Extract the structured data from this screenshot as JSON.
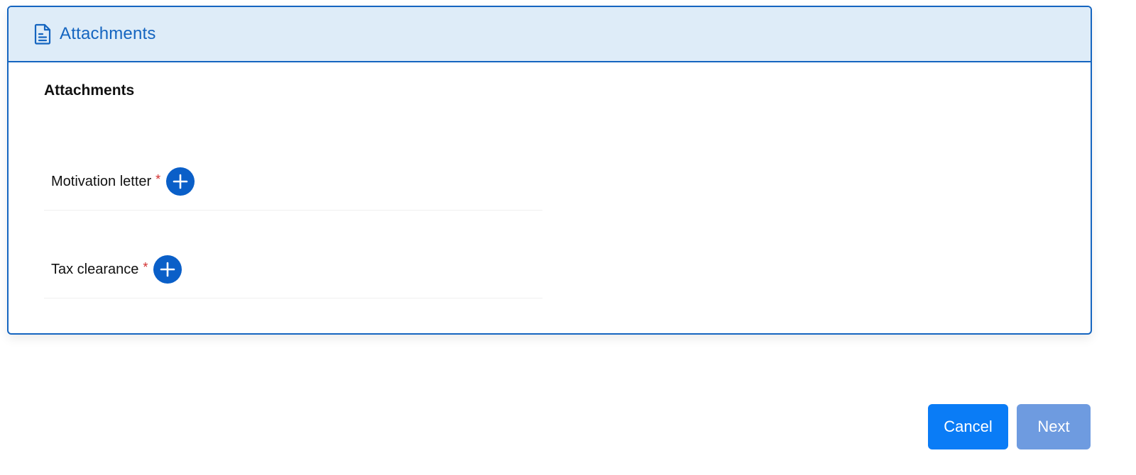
{
  "panel": {
    "header_title": "Attachments",
    "header_icon": "document-icon",
    "accent_color": "#1565c0",
    "header_bg": "#deecf8"
  },
  "section": {
    "title": "Attachments"
  },
  "fields": [
    {
      "label": "Motivation letter",
      "required_mark": "*",
      "action_icon": "plus-circle-icon"
    },
    {
      "label": "Tax clearance",
      "required_mark": "*",
      "action_icon": "plus-circle-icon"
    }
  ],
  "footer": {
    "cancel_label": "Cancel",
    "next_label": "Next",
    "next_state": "disabled"
  }
}
